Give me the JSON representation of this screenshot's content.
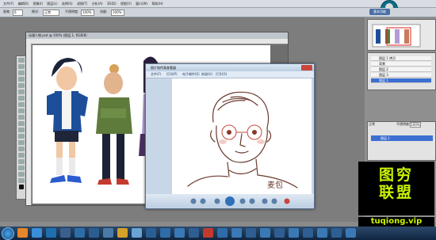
{
  "menubar": {
    "items": [
      "文件(F)",
      "编辑(E)",
      "图像(I)",
      "图层(L)",
      "选择(S)",
      "滤镜(T)",
      "分析(A)",
      "3D(D)",
      "视图(V)",
      "窗口(W)",
      "帮助(H)"
    ]
  },
  "optbar": {
    "brush_label": "画笔:",
    "brush_size": "6",
    "mode_label": "模式:",
    "mode_value": "正常",
    "opacity_label": "不透明度:",
    "opacity_value": "100%",
    "flow_label": "流量:",
    "flow_value": "100%",
    "workspace_button": "基本功能"
  },
  "document": {
    "title": "动漫人物.psd @ 100% (图层 1, RGB/8)"
  },
  "viewer": {
    "title": "图片和传真查看器",
    "menu": [
      "文件(F)",
      "打印(P)",
      "电子邮件(E)",
      "刻录(U)",
      "打开(O)"
    ]
  },
  "layers": {
    "items": [
      "图层 1 拷贝",
      "背景",
      "图层 2",
      "图层 3",
      "图层 1"
    ],
    "selected_index": 4
  },
  "channels": {
    "tab": "正常",
    "opacity_label": "不透明度:",
    "opacity_value": "100%",
    "selected_layer": "图层 1"
  },
  "signature": "麦包",
  "watermark": {
    "line1": "图穷",
    "line2": "联盟",
    "url": "tuqiong.vip"
  },
  "colors": {
    "accent": "#3d6fd1",
    "watermark": "#c9f500",
    "taskbar": "#0f2540"
  }
}
